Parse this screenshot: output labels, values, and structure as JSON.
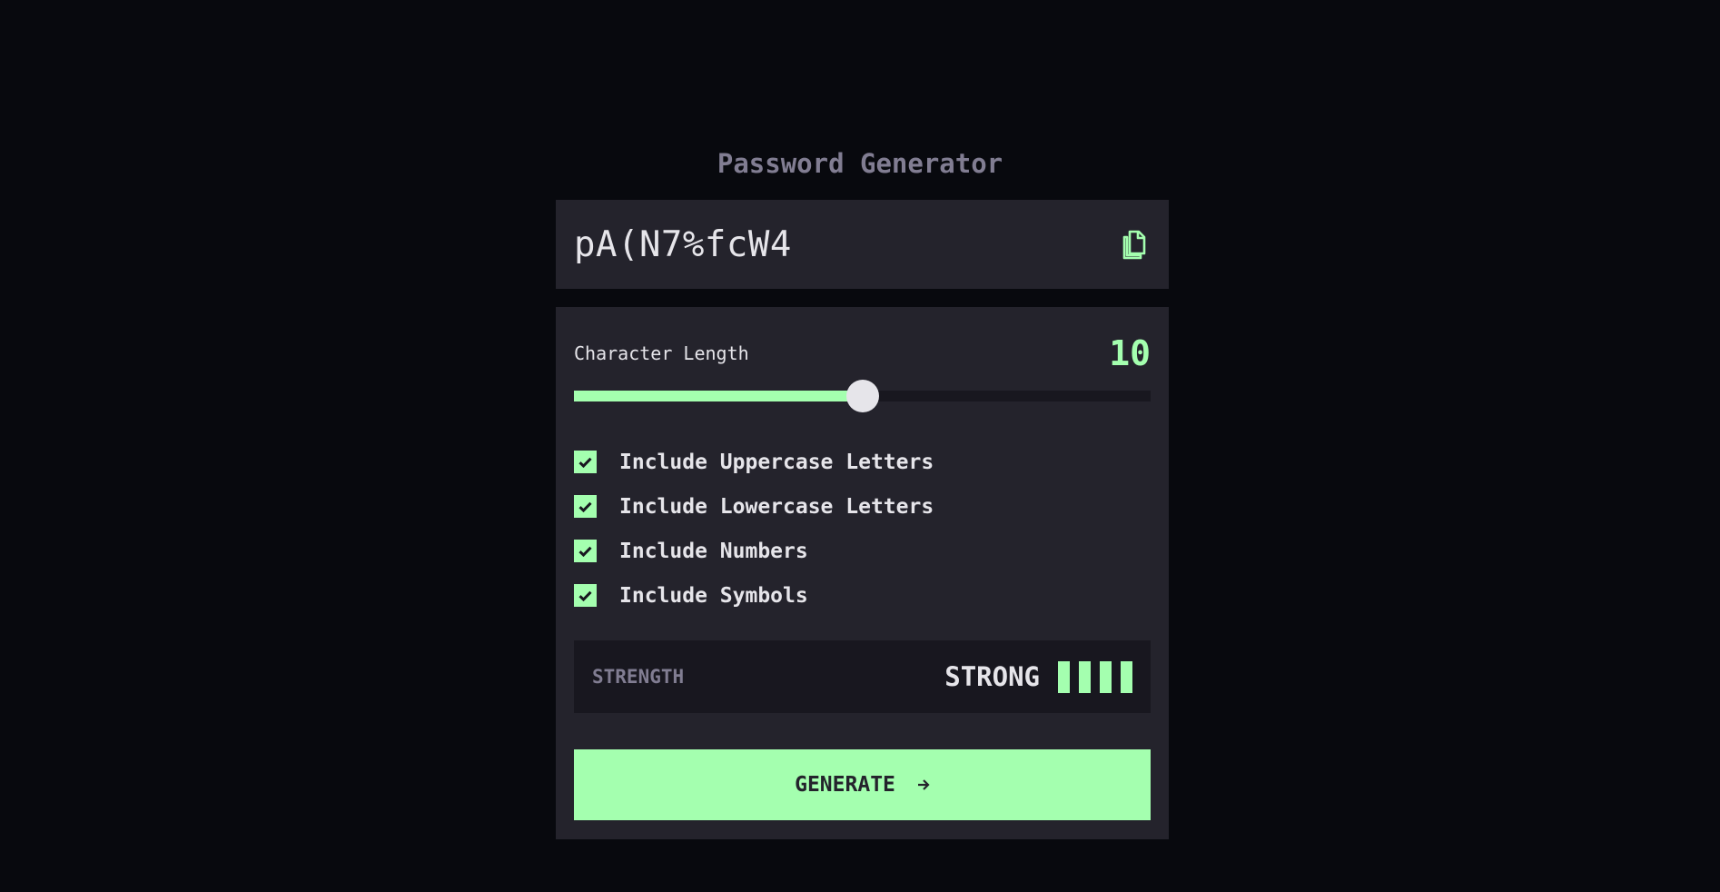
{
  "app": {
    "title": "Password Generator"
  },
  "password": {
    "value": "pA(N7%fcW4",
    "copy_icon": "copy-icon"
  },
  "length": {
    "label": "Character Length",
    "value": "10",
    "slider_fraction": 0.5
  },
  "options": [
    {
      "label": "Include Uppercase Letters",
      "checked": true
    },
    {
      "label": "Include Lowercase Letters",
      "checked": true
    },
    {
      "label": "Include Numbers",
      "checked": true
    },
    {
      "label": "Include Symbols",
      "checked": true
    }
  ],
  "strength": {
    "label": "STRENGTH",
    "value": "STRONG",
    "level": 4,
    "max_level": 4
  },
  "generate": {
    "label": "GENERATE",
    "icon": "arrow-right-icon"
  },
  "colors": {
    "accent": "#a4ffaf",
    "background": "#08090e",
    "panel": "#24232c",
    "inset": "#18171f",
    "text": "#e6e5ea",
    "muted": "#817d92"
  }
}
